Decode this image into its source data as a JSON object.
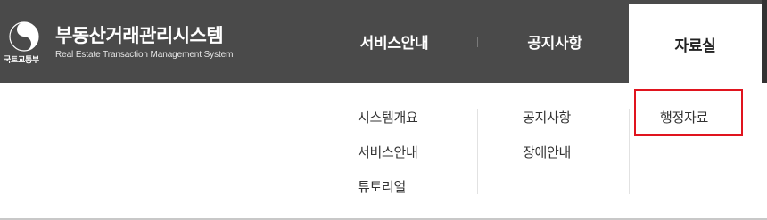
{
  "brand": {
    "title": "부동산거래관리시스템",
    "subtitle": "Real Estate Transaction Management System",
    "ministry": "국토교통부",
    "emblem_icon": "taegeuk-emblem-icon"
  },
  "nav": {
    "items": [
      {
        "label": "서비스안내"
      },
      {
        "label": "공지사항"
      },
      {
        "label": "자료실",
        "active": true
      }
    ]
  },
  "submenu": {
    "service": [
      "시스템개요",
      "서비스안내",
      "튜토리얼"
    ],
    "notice": [
      "공지사항",
      "장애안내"
    ],
    "data": [
      "행정자료"
    ]
  },
  "colors": {
    "topbar": "#4a4a4a",
    "active_tab": "#ffffff",
    "highlight": "#e0141e",
    "text": "#333333"
  }
}
